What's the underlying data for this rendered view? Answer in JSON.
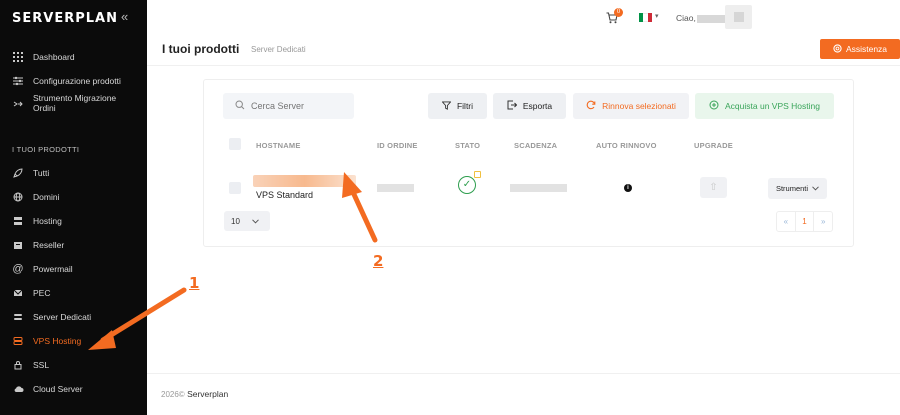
{
  "brand": {
    "name": "SERVERPLAN",
    "collapse_glyph": "«"
  },
  "sidebar": {
    "items_top": [
      {
        "label": "Dashboard",
        "icon": "grid-icon"
      },
      {
        "label": "Configurazione prodotti",
        "icon": "sliders-icon"
      },
      {
        "label": "Strumento Migrazione Ordini",
        "icon": "migrate-icon"
      }
    ],
    "section_title": "I TUOI PRODOTTI",
    "items_products": [
      {
        "label": "Tutti",
        "icon": "rocket-icon"
      },
      {
        "label": "Domini",
        "icon": "globe-icon"
      },
      {
        "label": "Hosting",
        "icon": "server-icon"
      },
      {
        "label": "Reseller",
        "icon": "reseller-icon"
      },
      {
        "label": "Powermail",
        "icon": "at-icon"
      },
      {
        "label": "PEC",
        "icon": "mail-icon"
      },
      {
        "label": "Server Dedicati",
        "icon": "server-stack-icon"
      },
      {
        "label": "VPS Hosting",
        "icon": "vps-icon",
        "active": true
      },
      {
        "label": "SSL",
        "icon": "lock-icon"
      },
      {
        "label": "Cloud Server",
        "icon": "cloud-icon"
      }
    ]
  },
  "topbar": {
    "cart_count": "0",
    "hello": "Ciao,",
    "flag_colors": [
      "#009246",
      "#ffffff",
      "#ce2b37"
    ]
  },
  "page": {
    "title": "I tuoi prodotti",
    "subtitle": "Server Dedicati",
    "help_label": "Assistenza"
  },
  "toolbar": {
    "search_placeholder": "Cerca Server",
    "filters_label": "Filtri",
    "export_label": "Esporta",
    "renew_label": "Rinnova selezionati",
    "buy_label": "Acquista un VPS Hosting"
  },
  "table": {
    "headers": [
      "HOSTNAME",
      "ID ORDINE",
      "STATO",
      "SCADENZA",
      "AUTO RINNOVO",
      "UPGRADE"
    ],
    "row": {
      "product": "VPS Standard",
      "tools_label": "Strumenti"
    }
  },
  "pagination": {
    "page_size": "10",
    "prev": "«",
    "current": "1",
    "next": "»"
  },
  "footer": {
    "year": "2026©",
    "company": "Serverplan"
  },
  "annotations": [
    "1",
    "2"
  ],
  "colors": {
    "accent": "#f36b21",
    "success": "#2e9e4e",
    "sidebar_bg": "#0b0b0b"
  }
}
